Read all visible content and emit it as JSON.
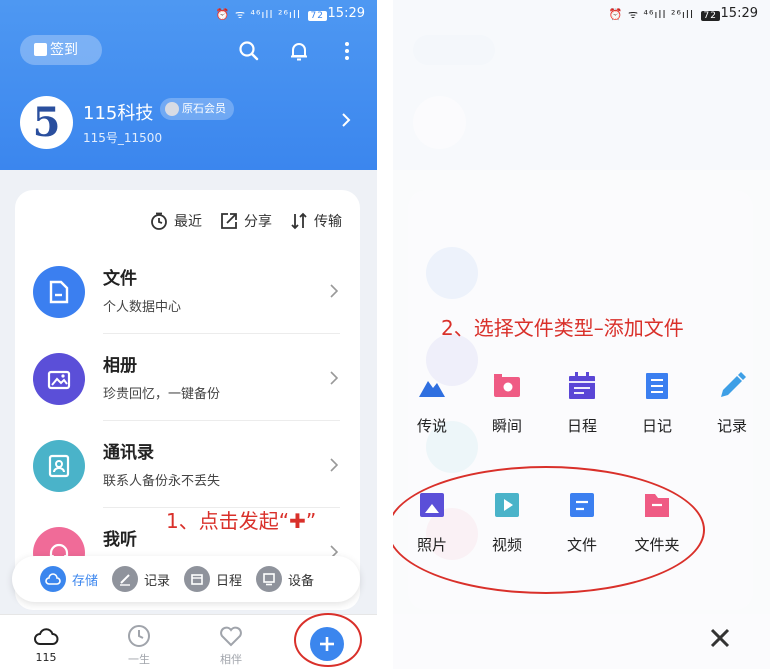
{
  "status": {
    "network": "⏰ ᯤ ⁴⁶ıll ²⁶ıll",
    "battery": "72",
    "time": "15:29"
  },
  "header": {
    "signin_label": "签到",
    "username": "115科技",
    "member_label": "原石会员",
    "user_id": "115号_11500",
    "avatar_glyph": "5"
  },
  "quick_actions": [
    "最近",
    "分享",
    "传输"
  ],
  "list": [
    {
      "title": "文件",
      "subtitle": "个人数据中心",
      "color": "#3b7ff0",
      "icon": "file-icon"
    },
    {
      "title": "相册",
      "subtitle": "珍贵回忆，一键备份",
      "color": "#5b4fd8",
      "icon": "photo-album-icon"
    },
    {
      "title": "通讯录",
      "subtitle": "联系人备份永不丢失",
      "color": "#4ab3c9",
      "icon": "contacts-icon"
    },
    {
      "title": "我听",
      "subtitle": "",
      "color": "#f06b98",
      "icon": "headphones-icon"
    }
  ],
  "tab_pill": [
    {
      "label": "存储",
      "icon": "cloud-icon",
      "active": true
    },
    {
      "label": "记录",
      "icon": "pen-icon",
      "active": false
    },
    {
      "label": "日程",
      "icon": "calendar-icon",
      "active": false
    },
    {
      "label": "设备",
      "icon": "monitor-icon",
      "active": false
    }
  ],
  "bottom_nav": [
    {
      "label": "115",
      "icon": "cloud-icon",
      "active": true
    },
    {
      "label": "一生",
      "icon": "clock-icon",
      "active": false
    },
    {
      "label": "相伴",
      "icon": "heart-icon",
      "active": false
    }
  ],
  "annotations": {
    "step1": "1、点击发起“✚”",
    "step2": "2、选择文件类型–添加文件"
  },
  "add_menu": {
    "row1": [
      {
        "label": "传说",
        "icon": "mountain-icon",
        "color": "#2f6fe0"
      },
      {
        "label": "瞬间",
        "icon": "camera-icon",
        "color": "#ef5b84"
      },
      {
        "label": "日程",
        "icon": "calendar-icon",
        "color": "#5a46d6"
      },
      {
        "label": "日记",
        "icon": "notebook-icon",
        "color": "#3b7ff0"
      },
      {
        "label": "记录",
        "icon": "pencil-icon",
        "color": "#3e9fe6"
      }
    ],
    "row2": [
      {
        "label": "照片",
        "icon": "photo-icon",
        "color": "#5b4fd8"
      },
      {
        "label": "视频",
        "icon": "video-icon",
        "color": "#4ab3c9"
      },
      {
        "label": "文件",
        "icon": "file-icon",
        "color": "#3b7ff0"
      },
      {
        "label": "文件夹",
        "icon": "folder-icon",
        "color": "#ef5b84"
      }
    ]
  },
  "colors": {
    "accent": "#3b86ee",
    "annotation": "#d9302a"
  }
}
